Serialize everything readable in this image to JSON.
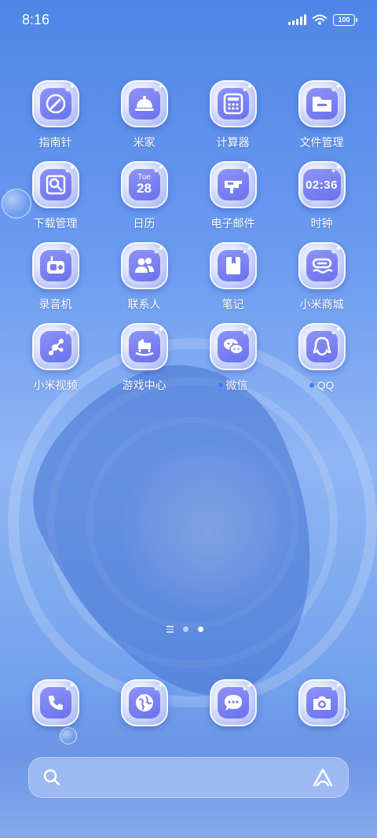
{
  "status_bar": {
    "time": "8:16",
    "battery": "100"
  },
  "apps": [
    {
      "name": "compass",
      "label": "指南针",
      "icon": "compass-icon"
    },
    {
      "name": "mi-home",
      "label": "米家",
      "icon": "cloche-icon"
    },
    {
      "name": "calculator",
      "label": "计算器",
      "icon": "calculator-icon"
    },
    {
      "name": "file-manager",
      "label": "文件管理",
      "icon": "folder-icon"
    },
    {
      "name": "download-manager",
      "label": "下载管理",
      "icon": "download-icon"
    },
    {
      "name": "calendar",
      "label": "日历",
      "icon": "calendar-icon",
      "day": "Tue",
      "date": "28"
    },
    {
      "name": "email",
      "label": "电子邮件",
      "icon": "mailbox-icon"
    },
    {
      "name": "clock",
      "label": "时钟",
      "icon": "clock-icon",
      "time": "02:36"
    },
    {
      "name": "recorder",
      "label": "录音机",
      "icon": "radio-icon"
    },
    {
      "name": "contacts",
      "label": "联系人",
      "icon": "contacts-icon"
    },
    {
      "name": "notes",
      "label": "笔记",
      "icon": "notebook-icon"
    },
    {
      "name": "mi-store",
      "label": "小米商城",
      "icon": "store-icon"
    },
    {
      "name": "mi-video",
      "label": "小米视频",
      "icon": "share-nodes-icon"
    },
    {
      "name": "game-center",
      "label": "游戏中心",
      "icon": "rocking-horse-icon"
    },
    {
      "name": "wechat",
      "label": "微信",
      "icon": "wechat-icon",
      "notification_dot": true
    },
    {
      "name": "qq",
      "label": "QQ",
      "icon": "penguin-icon",
      "notification_dot": true
    }
  ],
  "dock": [
    {
      "name": "phone",
      "icon": "phone-icon"
    },
    {
      "name": "browser",
      "icon": "globe-icon"
    },
    {
      "name": "messages",
      "icon": "message-icon"
    },
    {
      "name": "camera",
      "icon": "camera-icon"
    }
  ],
  "page_indicator": {
    "pages": 2,
    "active_page": 2
  },
  "search_bar": {
    "left_icon": "search-icon",
    "right_icon": "assistant-icon"
  },
  "colors": {
    "accent": "#6a72ee",
    "notification_dot": "#3f7bf5"
  }
}
